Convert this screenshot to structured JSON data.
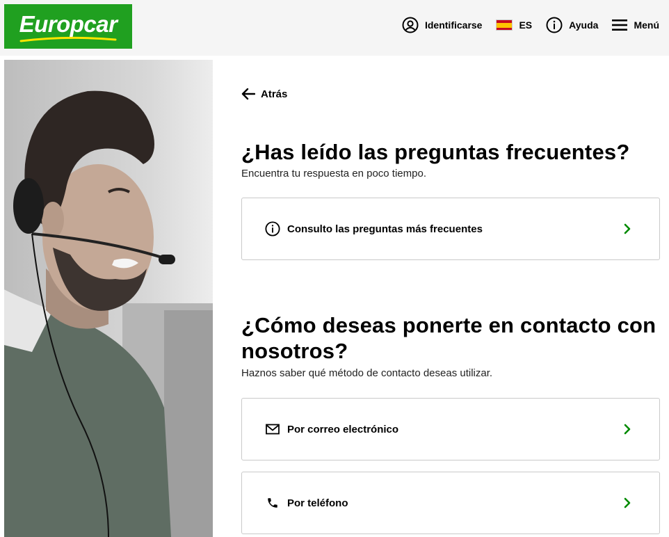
{
  "header": {
    "logo_text": "Europcar",
    "nav": {
      "login_label": "Identificarse",
      "language_label": "ES",
      "help_label": "Ayuda",
      "menu_label": "Menú"
    }
  },
  "main": {
    "back_label": "Atrás",
    "faq_section": {
      "title": "¿Has leído las preguntas frecuentes?",
      "subtitle": "Encuentra tu respuesta en poco tiempo.",
      "card_label": "Consulto las preguntas más frecuentes"
    },
    "contact_section": {
      "title_line1": "¿Cómo deseas ponerte en contacto con",
      "title_line2": "nosotros?",
      "subtitle": "Haznos saber qué método de contacto deseas utilizar.",
      "options": [
        {
          "label": "Por correo electrónico",
          "icon": "envelope-icon"
        },
        {
          "label": "Por teléfono",
          "icon": "phone-icon"
        }
      ]
    }
  },
  "colors": {
    "brand_green": "#20a020",
    "chevron_green": "#008a00",
    "header_bg": "#f5f5f5",
    "card_border": "#c9c9c9"
  },
  "icons": [
    "user-circle-icon",
    "spain-flag-icon",
    "info-icon",
    "hamburger-icon",
    "arrow-left-icon",
    "chevron-right-icon",
    "envelope-icon",
    "phone-icon"
  ]
}
